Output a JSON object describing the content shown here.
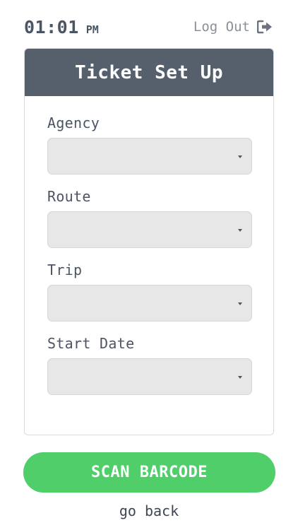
{
  "header": {
    "time": "01:01",
    "ampm": "PM",
    "logout_label": "Log Out",
    "logout_icon": "sign-out-icon"
  },
  "card": {
    "title": "Ticket Set Up",
    "fields": [
      {
        "label": "Agency",
        "value": ""
      },
      {
        "label": "Route",
        "value": ""
      },
      {
        "label": "Trip",
        "value": ""
      },
      {
        "label": "Start Date",
        "value": ""
      }
    ]
  },
  "actions": {
    "scan_label": "SCAN BARCODE",
    "back_label": "go back"
  },
  "colors": {
    "header_bg": "#56606c",
    "scan_button": "#4fce6a",
    "select_bg": "#e7e7e7"
  }
}
